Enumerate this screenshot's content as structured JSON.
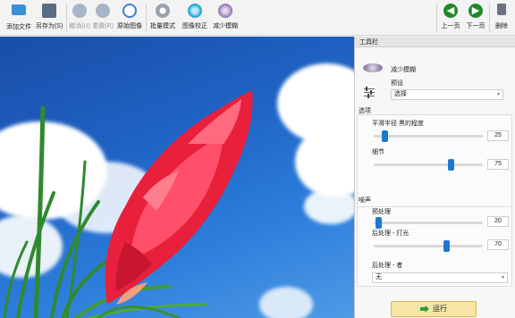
{
  "toolbar": {
    "add_file": "添加文件",
    "save_as": "另存为(S)",
    "undo": "撤消(U)",
    "redo": "重做(R)",
    "restore": "原始图像",
    "batch": "批量模式",
    "correct": "图像校正",
    "reduce": "减少模糊",
    "prev": "上一页",
    "next": "下一页",
    "delete": "删除"
  },
  "panel": {
    "title": "工具栏",
    "effect_name": "减少模糊",
    "preset_label": "预设",
    "preset_value": "选择",
    "options_title": "选项",
    "radius_label": "平滑半径 黑的程度",
    "radius_value": "25",
    "radius_fraction": 0.12,
    "detail_label": "细节",
    "detail_value": "75",
    "detail_fraction": 0.72,
    "noise_title": "噪声",
    "pre_label": "预处理",
    "pre_value": "20",
    "pre_fraction": 0.02,
    "post_label": "后处理 - 打光",
    "post_value": "70",
    "post_fraction": 0.65,
    "post2_label": "后处理 - 者",
    "post2_value": "无",
    "run_label": "运行"
  },
  "colors": {
    "accent": "#1e78d0",
    "sky": "#1f64c6",
    "flower": "#e8203c",
    "leaf": "#2f8a2f"
  }
}
